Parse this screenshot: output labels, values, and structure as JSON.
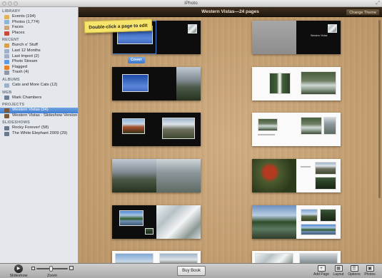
{
  "window": {
    "title": "iPhoto"
  },
  "sidebar": {
    "sections": [
      {
        "header": "LIBRARY",
        "items": [
          {
            "label": "Events (194)",
            "icon": "events-icon",
            "color": "#e0b35a"
          },
          {
            "label": "Photos (1,774)",
            "icon": "photos-icon",
            "color": "#8fb4d9"
          },
          {
            "label": "Faces",
            "icon": "faces-icon",
            "color": "#caa57c"
          },
          {
            "label": "Places",
            "icon": "places-icon",
            "color": "#c94a3a"
          }
        ]
      },
      {
        "header": "RECENT",
        "items": [
          {
            "label": "Bunch o' Stuff",
            "icon": "event-icon",
            "color": "#d7a04c"
          },
          {
            "label": "Last 12 Months",
            "icon": "calendar-icon",
            "color": "#9fb1c6"
          },
          {
            "label": "Last Import (2)",
            "icon": "import-icon",
            "color": "#9fb1c6"
          },
          {
            "label": "Photo Stream",
            "icon": "photo-stream-icon",
            "color": "#5f9be0"
          },
          {
            "label": "Flagged",
            "icon": "flag-icon",
            "color": "#e5822a"
          },
          {
            "label": "Trash (4)",
            "icon": "trash-icon",
            "color": "#8f98a3"
          }
        ]
      },
      {
        "header": "ALBUMS",
        "items": [
          {
            "label": "Cats and More Cats (12)",
            "icon": "album-icon",
            "color": "#9fb1c6"
          }
        ]
      },
      {
        "header": "WEB",
        "items": [
          {
            "label": "Mark Chambers",
            "icon": "web-album-icon",
            "color": "#6c7f94"
          }
        ]
      },
      {
        "header": "PROJECTS",
        "items": [
          {
            "label": "Western Vistas (34)",
            "icon": "book-icon",
            "color": "#7a5a3a",
            "selected": true
          },
          {
            "label": "Western Vistas - Slideshow Version (34)",
            "icon": "slideshow-project-icon",
            "color": "#7a5a3a"
          }
        ]
      },
      {
        "header": "SLIDESHOWS",
        "items": [
          {
            "label": "Rocky Forever! (58)",
            "icon": "slideshow-icon",
            "color": "#6a7a8c"
          },
          {
            "label": "The White Elephant 2009 (29)",
            "icon": "slideshow-icon",
            "color": "#6a7a8c"
          }
        ]
      }
    ]
  },
  "header": {
    "title": "Western Vistas—24 pages",
    "change_theme": "Change Theme"
  },
  "canvas": {
    "tooltip": "Double-click a page to edit",
    "cover_label": "Cover",
    "cover_text": "Western Vistas"
  },
  "toolbar": {
    "slideshow": "Slideshow",
    "zoom": "Zoom",
    "zoom_level": 0.45,
    "buy_book": "Buy Book",
    "add_page": "Add Page",
    "layout": "Layout",
    "options": "Options",
    "photos": "Photos"
  }
}
